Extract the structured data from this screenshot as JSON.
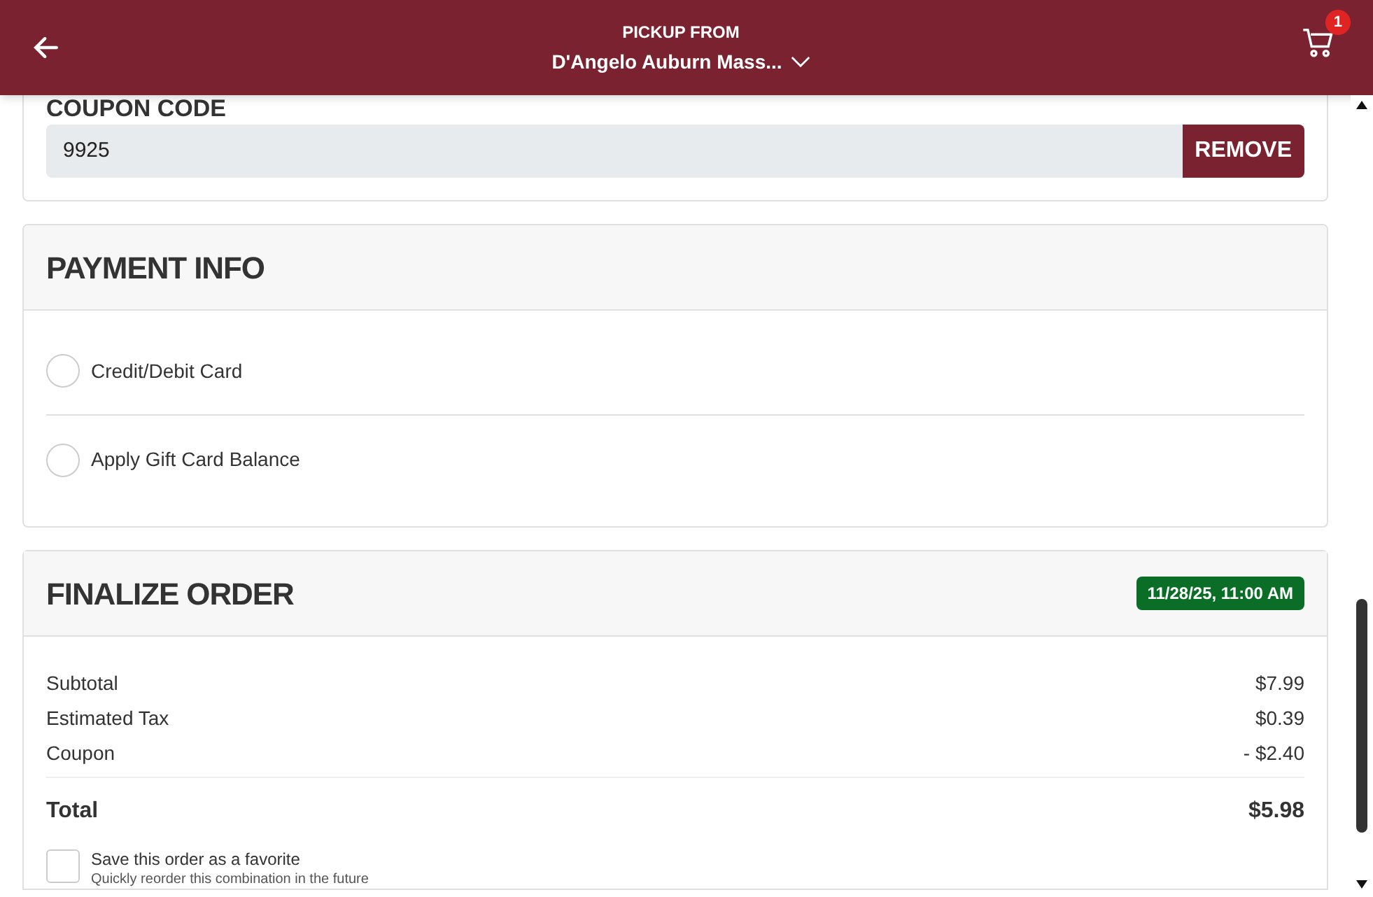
{
  "header": {
    "label": "PICKUP FROM",
    "location": "D'Angelo Auburn Mass...",
    "cart_count": "1"
  },
  "coupon": {
    "title": "COUPON CODE",
    "value": "9925",
    "button": "REMOVE"
  },
  "payment": {
    "title": "PAYMENT INFO",
    "options": [
      {
        "label": "Credit/Debit Card",
        "selected": false
      },
      {
        "label": "Apply Gift Card Balance",
        "selected": false
      }
    ]
  },
  "finalize": {
    "title": "FINALIZE ORDER",
    "time": "11/28/25, 11:00 AM",
    "lines": [
      {
        "label": "Subtotal",
        "amount": "$7.99"
      },
      {
        "label": "Estimated Tax",
        "amount": "$0.39"
      },
      {
        "label": "Coupon",
        "amount": "- $2.40"
      }
    ],
    "total": {
      "label": "Total",
      "amount": "$5.98"
    },
    "favorite": {
      "label": "Save this order as a favorite",
      "hint": "Quickly reorder this combination in the future",
      "checked": false
    }
  }
}
